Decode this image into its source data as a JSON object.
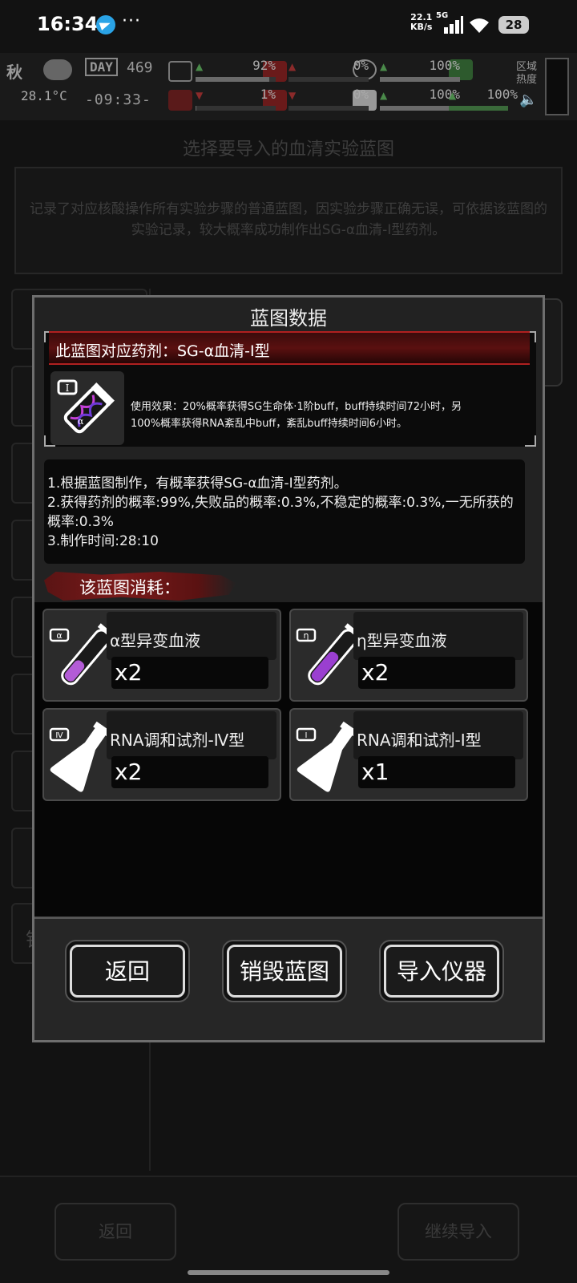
{
  "status_bar": {
    "time": "16:34",
    "dots": "···",
    "speed_value": "22.1",
    "speed_unit": "KB/s",
    "network": "5G",
    "battery": "28"
  },
  "hud": {
    "season": "秋",
    "temperature": "28.1°C",
    "day_label": "DAY",
    "day_number": "469",
    "clock": "-09:33-",
    "stats": [
      {
        "arrow": "▲",
        "value": "92%",
        "fill": 0.92
      },
      {
        "arrow": "▲",
        "value": "0%",
        "fill": 0.0
      },
      {
        "arrow": "▲",
        "value": "100%",
        "fill": 1.0
      },
      {
        "arrow": "▲",
        "value": "100%",
        "fill": 1.0
      },
      {
        "arrow": "▼",
        "value": "1%",
        "fill": 0.01
      },
      {
        "arrow": "▼",
        "value": "0%",
        "fill": 0.0
      },
      {
        "arrow": "▲",
        "value": "100%",
        "fill": 1.0
      }
    ],
    "area_heat_label": "区域\n热度"
  },
  "background": {
    "title": "选择要导入的血清实验蓝图",
    "description": "记录了对应核酸操作所有实验步骤的普通蓝图，因实验步骤正确无误，可依据该蓝图的实验记录，较大概率成功制作出SG-α血清-Ⅰ型药剂。",
    "slot_partial_text": "销",
    "back_button": "返回",
    "continue_button": "继续导入"
  },
  "dialog": {
    "title": "蓝图数据",
    "blueprint_name": "此蓝图对应药剂：SG-α血清-Ⅰ型",
    "effect_line1": "使用效果：20%概率获得SG生命体·1阶buff，buff持续时间72小时，另",
    "effect_line2": "100%概率获得RNA紊乱中buff，紊乱buff持续时间6小时。",
    "notes": [
      "1.根据蓝图制作，有概率获得SG-α血清-Ⅰ型药剂。",
      "2.获得药剂的概率:99%,失败品的概率:0.3%,不稳定的概率:0.3%,一无所获的概率:0.3%",
      "3.制作时间:28:10"
    ],
    "consume_label": "该蓝图消耗：",
    "materials": [
      {
        "badge": "α",
        "name": "α型异变血液",
        "qty": "x2",
        "kind": "tube",
        "color": "#b35cd6"
      },
      {
        "badge": "η",
        "name": "η型异变血液",
        "qty": "x2",
        "kind": "tube",
        "color": "#9a3fd0"
      },
      {
        "badge": "Ⅳ",
        "name": "RNA调和试剂-Ⅳ型",
        "qty": "x2",
        "kind": "flask",
        "color": "#ffffff"
      },
      {
        "badge": "Ⅰ",
        "name": "RNA调和试剂-Ⅰ型",
        "qty": "x1",
        "kind": "flask",
        "color": "#ffffff"
      }
    ],
    "buttons": {
      "back": "返回",
      "destroy": "销毁蓝图",
      "import": "导入仪器"
    }
  }
}
